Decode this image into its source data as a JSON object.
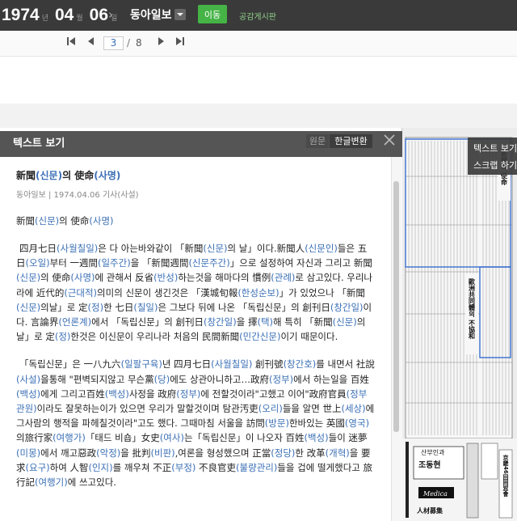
{
  "topbar": {
    "year": "1974",
    "year_unit": "년",
    "month": "04",
    "month_unit": "월",
    "day": "06",
    "day_unit": "일",
    "paper_name": "동아일보",
    "go_label": "이동",
    "public_board_label": "공감게시판"
  },
  "pager": {
    "current_page": "3",
    "separator": "/",
    "total_pages": "8"
  },
  "text_panel": {
    "title": "텍스트 보기",
    "tab_original": "원문",
    "tab_converted": "한글변환",
    "article_title": "新聞(신문)의 使命(사명)",
    "article_meta": "동아일보 | 1974.04.06 기사(사설)",
    "article_subtitle": "新聞(신문)의 使命(사명)",
    "paragraph_1": "四月七日(사월칠일)은 다 아는바와같이 「新聞(신문)의 날」이다.新聞人(신문인)들은 五日(오일)부터 一週間(일주간)을 「新聞週間(신문주간)」으로 설정하여 자신과 그리고 新聞(신문)의 使命(사명)에 관해서 反省(반성)하는것을 해마다의 慣例(관례)로 삼고있다. 우리나라에 近代的(근대적)의미의 신문이 생긴것은 「漢城旬報(한성순보)」가 있었으나 「新聞(신문)의날」로 定(정)한 七日(칠일)은 그보다 뒤에 나온 「독립신문」의 創刊日(창간일)이다. 言論界(언론계)에서 「독립신문」의 創刊日(창간일)을 擇(택)해 특히 「新聞(신문)의날」로 定(정)한것은 이신문이 우리나라 처음의 民間新聞(민간신문)이기 때문이다.",
    "paragraph_2": "「독립신문」은 一八九六(일팔구육)년 四月七日(사월칠일) 創刊號(창간호)를 내면서 社說(사설)을통해 \"편벽되지않고 무슨黨(당)에도 상관아니하고…政府(정부)에서 하는일을 百姓(백성)에게 그리고百姓(백성)사정을 政府(정부)에 전할것이라\"고했고 이어\"政府官員(정부관원)이라도 잘못하는이가 있으면 우리가 말할것이며 탐관汚吏(오리)들을 알면 世上(세상)에 그사람의 행적을 파헤칠것이라\"고도 했다. 그때마침 서울을 訪問(방문)한바있는 英國(영국)의旅行家(여행가)「태드 비숍」女史(여사)는「독립신문」이 나오자 百姓(백성)들이 迷夢(미몽)에서 깨고惡政(악정)을 批判(비판),여론을 형성했으며 正當(정당)한 改革(개혁)을 要求(요구)하여 人智(인지)를 깨우쳐 不正(부정) 不良官吏(불량관리)들을 겁에 떨게했다고 旅行記(여행기)에 쓰고있다."
  },
  "newspaper_thumb": {
    "headline_vertical": "新聞의 使命",
    "headline_2": "歐洲共同體의 不協和",
    "ad_1": "산부인과",
    "ad_1_name": "조동현",
    "ad_2": "人材募集",
    "ad_3": "京畿46回同窓會",
    "ad_4": "Medica"
  },
  "float_menu": {
    "item_1": "텍스트 보기",
    "item_2": "스크랩 하기"
  },
  "colors": {
    "topbar_bg": "#3a3a3a",
    "go_button": "#45b346",
    "highlight_hanja": "#3b6fb6"
  }
}
